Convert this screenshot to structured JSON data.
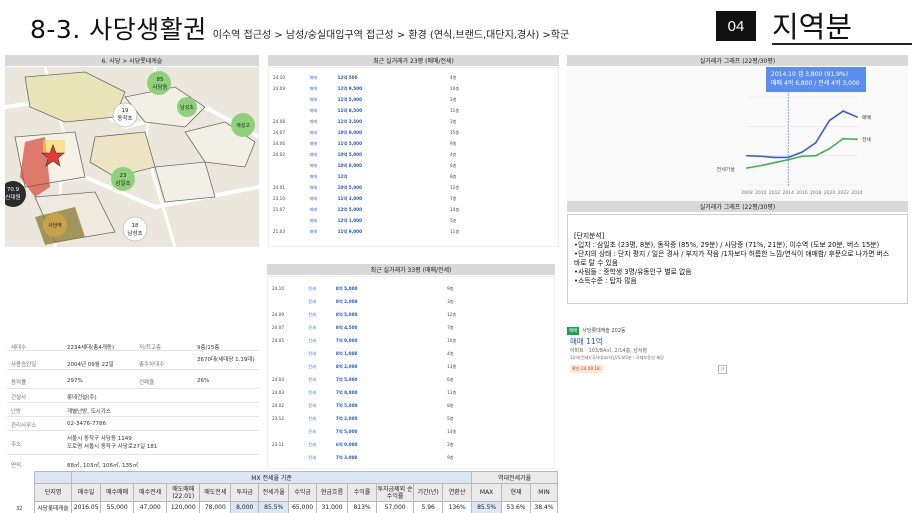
{
  "header": {
    "title": "8-3. 사당생활권",
    "subtitle": "이수역 접근성 > 남성/숭실대입구역 접근성 > 환경 (연식,브랜드,대단지,경사) >학군",
    "badge": "04",
    "region": "지역분"
  },
  "map": {
    "caption": "6. 사당 > 사당롯데캐슬",
    "labels": [
      {
        "text": "85\n사당동",
        "color": "#8fd17a"
      },
      {
        "text": "19\n동작초",
        "color": "#ffffff"
      },
      {
        "text": "남성초",
        "color": "#8fd17a"
      },
      {
        "text": "계성고",
        "color": "#8fd17a"
      },
      {
        "text": "23\n삼일초",
        "color": "#8fd17a"
      },
      {
        "text": "70.9\n신대원",
        "color": "#2b2b2b"
      },
      {
        "text": "18\n남성초",
        "color": "#ffffff"
      },
      {
        "text": "사당역",
        "color": "#c8a24a"
      }
    ]
  },
  "info_table": {
    "rows": [
      {
        "label": "세대수",
        "value": "2234세대(총4개동)",
        "label2": "저/최고층",
        "value2": "9층/15층"
      },
      {
        "label": "사용승인일",
        "value": "2004년 09월 22일",
        "label2": "총주차대수",
        "value2": "2670대(세대당 1.19대)"
      },
      {
        "label": "용적률",
        "value": "297%",
        "label2": "건폐율",
        "value2": "26%"
      },
      {
        "label": "건설사",
        "value": "롯데건설(주)",
        "label2": "",
        "value2": ""
      },
      {
        "label": "난방",
        "value": "개별난방, 도시가스",
        "label2": "",
        "value2": ""
      },
      {
        "label": "관리사무소",
        "value": "02-3476-7786",
        "label2": "",
        "value2": ""
      },
      {
        "label": "주소",
        "value": "서울시 동작구 사당동 1149\n도로명 서울시 동작구 사당로27길 181",
        "label2": "",
        "value2": ""
      },
      {
        "label": "면적",
        "value": "88㎡, 103㎡, 106㎡, 135㎡",
        "label2": "",
        "value2": ""
      }
    ]
  },
  "recent23": {
    "caption": "최근 실거래가 23평 (매매/전세)",
    "rows": [
      {
        "date": "24.10",
        "type": "매매",
        "price": "12억 500",
        "floor": "4층"
      },
      {
        "date": "24.09",
        "type": "매매",
        "price": "11억 9,500",
        "floor": "10층"
      },
      {
        "date": "",
        "type": "매매",
        "price": "11억 5,000",
        "floor": "2층"
      },
      {
        "date": "",
        "type": "매매",
        "price": "11억 8,500",
        "floor": "11층"
      },
      {
        "date": "24.08",
        "type": "매매",
        "price": "11억 3,500",
        "floor": "3층"
      },
      {
        "date": "24.07",
        "type": "매매",
        "price": "10억 9,000",
        "floor": "15층"
      },
      {
        "date": "24.06",
        "type": "매매",
        "price": "11억 5,000",
        "floor": "9층"
      },
      {
        "date": "24.02",
        "type": "매매",
        "price": "10억 5,000",
        "floor": "4층"
      },
      {
        "date": "",
        "type": "매매",
        "price": "10억 8,000",
        "floor": "6층"
      },
      {
        "date": "",
        "type": "매매",
        "price": "11억",
        "floor": "8층"
      },
      {
        "date": "24.01",
        "type": "매매",
        "price": "10억 5,000",
        "floor": "12층"
      },
      {
        "date": "23.10",
        "type": "매매",
        "price": "11억 3,000",
        "floor": "7층"
      },
      {
        "date": "21.07",
        "type": "매매",
        "price": "12억 5,000",
        "floor": "14층"
      },
      {
        "date": "",
        "type": "매매",
        "price": "12억 1,000",
        "floor": "5층"
      },
      {
        "date": "21.03",
        "type": "매매",
        "price": "11억 9,000",
        "floor": "11층"
      }
    ]
  },
  "recent33": {
    "caption": "최근 실거래가 33평 (매매/전세)",
    "rows": [
      {
        "date": "24.10",
        "type": "전세",
        "price": "8억 5,000",
        "floor": "9층"
      },
      {
        "date": "",
        "type": "전세",
        "price": "8억 2,000",
        "floor": "3층"
      },
      {
        "date": "24.09",
        "type": "전세",
        "price": "8억 5,000",
        "floor": "12층"
      },
      {
        "date": "24.07",
        "type": "전세",
        "price": "8억 4,500",
        "floor": "7층"
      },
      {
        "date": "24.05",
        "type": "전세",
        "price": "7억 9,000",
        "floor": "10층"
      },
      {
        "date": "",
        "type": "전세",
        "price": "8억 1,000",
        "floor": "4층"
      },
      {
        "date": "",
        "type": "전세",
        "price": "8억 2,000",
        "floor": "13층"
      },
      {
        "date": "24.04",
        "type": "전세",
        "price": "7억 5,000",
        "floor": "6층"
      },
      {
        "date": "24.03",
        "type": "전세",
        "price": "7억 8,000",
        "floor": "11층"
      },
      {
        "date": "24.02",
        "type": "전세",
        "price": "7억 5,000",
        "floor": "8층"
      },
      {
        "date": "23.12",
        "type": "전세",
        "price": "7억 2,000",
        "floor": "5층"
      },
      {
        "date": "",
        "type": "전세",
        "price": "7억 5,000",
        "floor": "14층"
      },
      {
        "date": "23.11",
        "type": "전세",
        "price": "6억 9,000",
        "floor": "2층"
      },
      {
        "date": "",
        "type": "전세",
        "price": "7억 3,000",
        "floor": "9층"
      }
    ]
  },
  "chart": {
    "caption": "실거래가 그래프 (22평/30평)",
    "tooltip_line1": "2014.10  갭 3,800 (91.9%)",
    "tooltip_line2": "매매 4억 6,800 / 전세 4억 3,000",
    "legend": [
      "매매",
      "전세"
    ],
    "bottom_label": "전세가율"
  },
  "chart_data": {
    "type": "line",
    "x": [
      "2008",
      "2010",
      "2012",
      "2014",
      "2016",
      "2018",
      "2020",
      "2022",
      "2024"
    ],
    "xlabel": "",
    "ylabel": "",
    "series": [
      {
        "name": "매매",
        "values": [
          5.0,
          4.9,
          4.7,
          4.7,
          5.6,
          7.2,
          11.0,
          12.6,
          11.6
        ]
      },
      {
        "name": "전세",
        "values": [
          2.9,
          3.3,
          3.8,
          4.3,
          4.9,
          5.0,
          6.2,
          7.9,
          7.8
        ]
      }
    ],
    "ylim": [
      0,
      15
    ],
    "colors": {
      "매매": "#3b5bdb",
      "전세": "#40b050"
    },
    "grid": true,
    "legend_position": "right"
  },
  "analysis": {
    "caption": "실거래가 그래프 (22평/30평)",
    "lines": [
      "[단지분석]",
      "•입지 : 삼일초 (23평, 8분), 동작중 (85%, 29분) / 사당중 (71%, 21분), 이수역 (도보 20분, 버스 15분)",
      "•단지의 상태 : 단지 평지 / 일은 경사 / 부지가 작음 /1차보다 허름한 느낌/연식이 애매함/ 후문으로 나가면 버스",
      "바로 탈 수 있음",
      "•사림들 : 중학생 3명/유동인구 별로 없음",
      "•소득수준 : 탑차 많음"
    ]
  },
  "listing": {
    "tag": "매매",
    "title": "사당롯데캐슬 202동",
    "price": "매매 11억",
    "line1": "아파트 · 103/84㎡, 2/14층, 남서향",
    "line2": "11억(전세)/국사대교/사당/도보5분 · 국제부동산 제공",
    "confirm": "확인 24.09.18."
  },
  "summary": {
    "group_header": "MX 전세율 기준",
    "group_header2": "역대전세가율",
    "headers": [
      "단지명",
      "매수일",
      "매수매매",
      "매수전세",
      "매도매매\n(22.01)",
      "매도전세",
      "투자금",
      "전세가율",
      "수익금",
      "현금흐름",
      "수익률",
      "투자금제외\n순수익률",
      "기간(년)",
      "연환산",
      "MAX",
      "현재",
      "MIN"
    ],
    "row": [
      "사당롯데캐슬",
      "2016.05",
      "55,000",
      "47,000",
      "120,000",
      "78,000",
      "8,000",
      "85.5%",
      "65,000",
      "31,000",
      "813%",
      "57,000",
      "5.96",
      "136%",
      "85.5%",
      "53.6%",
      "38.4%"
    ]
  },
  "page_number": "32"
}
